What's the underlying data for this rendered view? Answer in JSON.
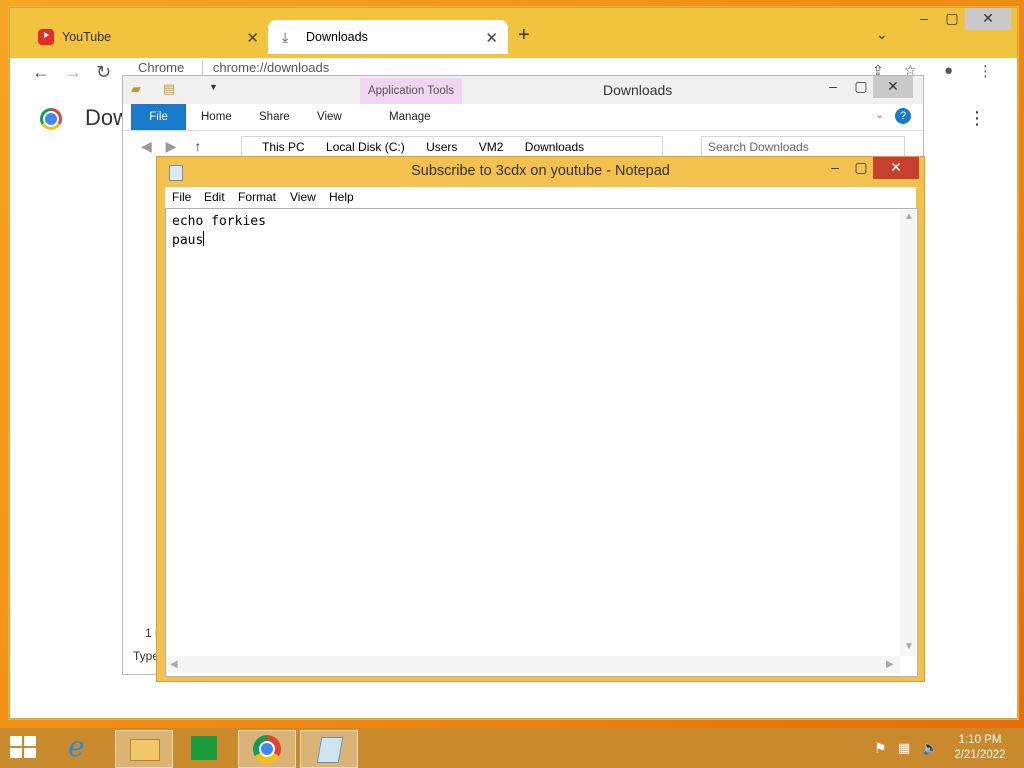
{
  "chrome": {
    "tabs": [
      {
        "label": "YouTube"
      },
      {
        "label": "Downloads"
      }
    ],
    "omnibox": {
      "site": "Chrome",
      "url": "chrome://downloads"
    },
    "page_title": "Dow"
  },
  "explorer": {
    "title": "Downloads",
    "app_tools": "Application Tools",
    "ribbon_tabs": [
      "File",
      "Home",
      "Share",
      "View",
      "Manage"
    ],
    "breadcrumb": [
      "This PC",
      "Local Disk (C:)",
      "Users",
      "VM2",
      "Downloads"
    ],
    "search_placeholder": "Search Downloads",
    "status_partial": "1 i",
    "type_partial": "Type"
  },
  "notepad": {
    "title": "Subscribe to 3cdx on youtube - Notepad",
    "menu": [
      "File",
      "Edit",
      "Format",
      "View",
      "Help"
    ],
    "lines": [
      "echo forkies",
      "paus"
    ]
  },
  "taskbar": {
    "time": "1:10 PM",
    "date": "2/21/2022"
  },
  "colors": {
    "desktop": "#ef8a12",
    "notepad_frame": "#f3c14d",
    "ribbon_file": "#1979ca",
    "close_red": "#c7402e"
  }
}
